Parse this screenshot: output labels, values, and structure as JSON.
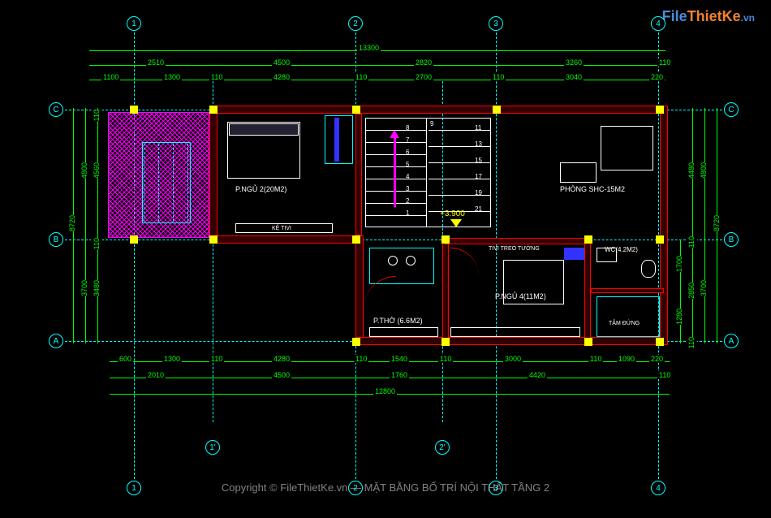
{
  "logo": {
    "part1": "File",
    "part2": "ThietKe",
    "part3": ".vn"
  },
  "title": "MẶT BẰNG BỐ TRÍ NỘI THẤT TẦNG 2",
  "watermark": "Copyright © FileThietKe.vn",
  "grid_axes": {
    "vertical": [
      "1",
      "1'",
      "2",
      "2'",
      "3",
      "4"
    ],
    "horizontal": [
      "A",
      "B",
      "C"
    ]
  },
  "dimensions": {
    "top_total": "13300",
    "top_row1": [
      "2510",
      "4500",
      "2820",
      "3260",
      "110"
    ],
    "top_row2": [
      "1100",
      "1300",
      "110",
      "4280",
      "110",
      "2700",
      "110",
      "3040",
      "220"
    ],
    "bottom_row1": [
      "600",
      "1300",
      "110",
      "4280",
      "110",
      "1540",
      "110",
      "3000",
      "110",
      "1090",
      "220"
    ],
    "bottom_row2": [
      "2010",
      "4500",
      "1760",
      "4420",
      "110"
    ],
    "bottom_total": "12800",
    "left_col1": [
      "4800",
      "3700"
    ],
    "left_col2": [
      "110",
      "4560",
      "110",
      "3480"
    ],
    "left_total": "8720",
    "right_col1": [
      "4480",
      "110",
      "2850",
      "110"
    ],
    "right_col2": [
      "4800",
      "3700"
    ],
    "right_total": "8720",
    "right_inner": [
      "1700",
      "1280"
    ]
  },
  "rooms": {
    "bedroom2": "P.NGỦ 2(20M2)",
    "living": "PHÒNG SHC-15M2",
    "bedroom4": "P.NGỦ 4(11M2)",
    "worship": "P.THỜ (6.6M2)",
    "wc": "WC(4.2M2)",
    "tv_shelf": "KỆ TIVI",
    "tv_wall": "TIVI TREO TƯỜNG",
    "shower": "TẮM ĐỨNG"
  },
  "elevation": "+3.900",
  "stairs": {
    "numbers_left": [
      "1",
      "2",
      "3",
      "4",
      "5",
      "6",
      "7",
      "8",
      "9"
    ],
    "numbers_right": [
      "11",
      "13",
      "15",
      "17",
      "19",
      "21"
    ]
  },
  "chart_data": {
    "type": "floor_plan",
    "floor": 2,
    "total_width_mm": 13300,
    "total_depth_mm": 8720,
    "elevation_m": 3.9,
    "rooms": [
      {
        "name": "P.NGỦ 2",
        "area_m2": 20,
        "type": "bedroom"
      },
      {
        "name": "PHÒNG SHC",
        "area_m2": 15,
        "type": "living"
      },
      {
        "name": "P.NGỦ 4",
        "area_m2": 11,
        "type": "bedroom"
      },
      {
        "name": "P.THỜ",
        "area_m2": 6.6,
        "type": "worship"
      },
      {
        "name": "WC",
        "area_m2": 4.2,
        "type": "bathroom"
      }
    ],
    "grid_spacing_h_mm": [
      2510,
      4500,
      2820,
      3260
    ],
    "grid_spacing_v_mm": [
      4800,
      3700
    ]
  }
}
